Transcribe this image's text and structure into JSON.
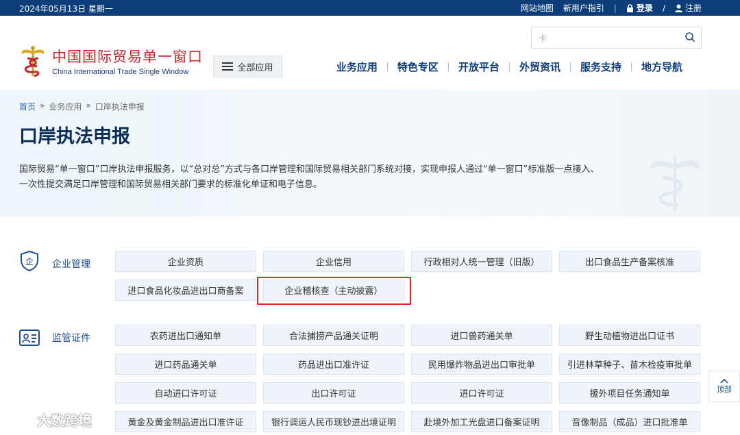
{
  "topbar": {
    "date": "2024年05月13日 星期一",
    "site_map": "网站地图",
    "guide": "新用户指引",
    "divider": "|",
    "login": "登录",
    "slash": "/",
    "register": "注册"
  },
  "header": {
    "logo_cn": "中国国际贸易单一窗口",
    "logo_en": "China International Trade Single Window",
    "all_apps": "全部应用",
    "search_placeholder": "卡",
    "nav": [
      "业务应用",
      "特色专区",
      "开放平台",
      "外贸资讯",
      "服务支持",
      "地方导航"
    ]
  },
  "hero": {
    "breadcrumb": [
      "首页",
      "»",
      "业务应用",
      "»",
      "口岸执法申报"
    ],
    "title": "口岸执法申报",
    "desc_line1": "国际贸易“单一窗口”口岸执法申报服务，以“总对总”方式与各口岸管理和国际贸易相关部门系统对接，实现申报人通过“单一窗口”标准版一点接入、",
    "desc_line2": "一次性提交满足口岸管理和国际贸易相关部门要求的标准化单证和电子信息。"
  },
  "sections": [
    {
      "label": "企业管理",
      "icon": "enterprise-shield-icon",
      "items": [
        "企业资质",
        "企业信用",
        "行政相对人统一管理（旧版）",
        "出口食品生产备案核准",
        "进口食品化妆品进出口商备案",
        "企业稽核查（主动披露）"
      ]
    },
    {
      "label": "监管证件",
      "icon": "id-card-icon",
      "items": [
        "农药进出口通知单",
        "合法捕捞产品通关证明",
        "进口兽药通关单",
        "野生动植物进出口证书",
        "进口药品通关单",
        "药品进出口准许证",
        "民用爆炸物品进出口审批单",
        "引进林草种子、苗木检疫审批单",
        "自动进口许可证",
        "出口许可证",
        "进口许可证",
        "援外项目任务通知单",
        "黄金及黄金制品进出口准许证",
        "银行调运人民币现钞进出境证明",
        "赴境外加工光盘进口备案证明",
        "音像制品（成品）进口批准单"
      ]
    }
  ],
  "totop": "顶部",
  "watermark": "大数跨境",
  "colors": {
    "topbar": "#0c3d78",
    "nav": "#0c3d78",
    "highlight": "#d42a2a",
    "button_bg": "#eef4f9"
  }
}
